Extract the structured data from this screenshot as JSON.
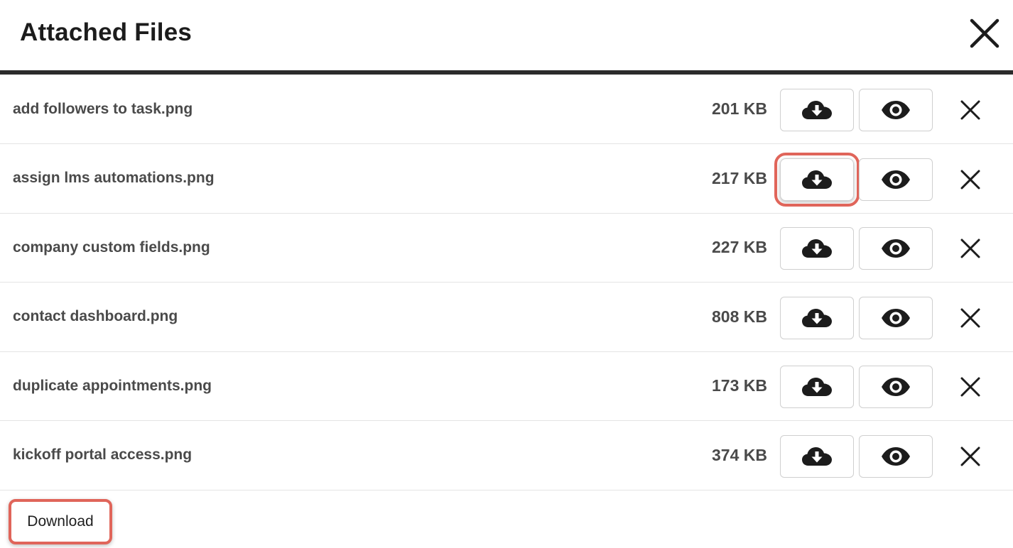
{
  "dialog": {
    "title": "Attached Files",
    "close_icon": "close-icon"
  },
  "files": [
    {
      "name": "add followers to task.png",
      "size": "201 KB"
    },
    {
      "name": "assign lms automations.png",
      "size": "217 KB",
      "highlighted": true
    },
    {
      "name": "company custom fields.png",
      "size": "227 KB"
    },
    {
      "name": "contact dashboard.png",
      "size": "808 KB"
    },
    {
      "name": "duplicate appointments.png",
      "size": "173 KB"
    },
    {
      "name": "kickoff portal access.png",
      "size": "374 KB"
    }
  ],
  "icons": {
    "download": "cloud-download-icon",
    "view": "eye-icon",
    "remove": "close-icon"
  },
  "footer": {
    "download_label": "Download"
  },
  "colors": {
    "highlight": "#e0655a",
    "text": "#4a4a4a",
    "divider": "#2b2b2b"
  }
}
